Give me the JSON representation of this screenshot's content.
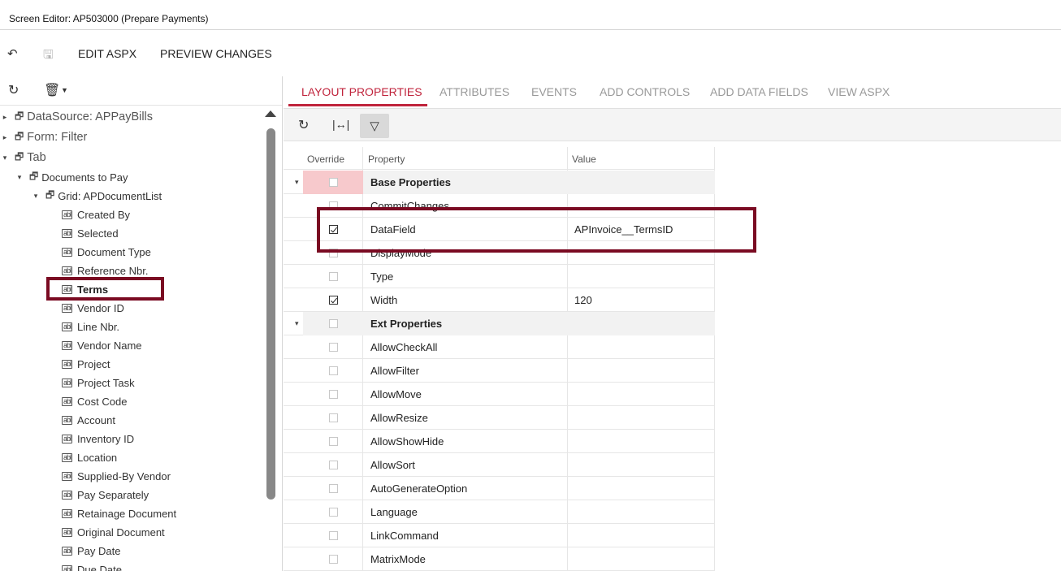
{
  "window": {
    "title": "Screen Editor: AP503000 (Prepare Payments)"
  },
  "toolbar": {
    "edit_aspx": "EDIT ASPX",
    "preview_changes": "PREVIEW CHANGES"
  },
  "tree": {
    "nodes": [
      {
        "label": "DataSource: APPayBills"
      },
      {
        "label": "Form: Filter"
      },
      {
        "label": "Tab"
      },
      {
        "label": "Documents to Pay"
      },
      {
        "label": "Grid: APDocumentList"
      },
      {
        "label": "Created By"
      },
      {
        "label": "Selected"
      },
      {
        "label": "Document Type"
      },
      {
        "label": "Reference Nbr."
      },
      {
        "label": "Terms"
      },
      {
        "label": "Vendor ID"
      },
      {
        "label": "Line Nbr."
      },
      {
        "label": "Vendor Name"
      },
      {
        "label": "Project"
      },
      {
        "label": "Project Task"
      },
      {
        "label": "Cost Code"
      },
      {
        "label": "Account"
      },
      {
        "label": "Inventory ID"
      },
      {
        "label": "Location"
      },
      {
        "label": "Supplied-By Vendor"
      },
      {
        "label": "Pay Separately"
      },
      {
        "label": "Retainage Document"
      },
      {
        "label": "Original Document"
      },
      {
        "label": "Pay Date"
      },
      {
        "label": "Due Date"
      }
    ]
  },
  "tabs": [
    {
      "label": "LAYOUT PROPERTIES"
    },
    {
      "label": "ATTRIBUTES"
    },
    {
      "label": "EVENTS"
    },
    {
      "label": "ADD CONTROLS"
    },
    {
      "label": "ADD DATA FIELDS"
    },
    {
      "label": "VIEW ASPX"
    }
  ],
  "grid": {
    "columns": {
      "override": "Override",
      "property": "Property",
      "value": "Value"
    },
    "rows": [
      {
        "property": "Base Properties",
        "value": "",
        "checked": false
      },
      {
        "property": "CommitChanges",
        "value": "",
        "checked": false
      },
      {
        "property": "DataField",
        "value": "APInvoice__TermsID",
        "checked": true
      },
      {
        "property": "DisplayMode",
        "value": "",
        "checked": false
      },
      {
        "property": "Type",
        "value": "",
        "checked": false
      },
      {
        "property": "Width",
        "value": "120",
        "checked": true
      },
      {
        "property": "Ext Properties",
        "value": "",
        "checked": false
      },
      {
        "property": "AllowCheckAll",
        "value": "",
        "checked": false
      },
      {
        "property": "AllowFilter",
        "value": "",
        "checked": false
      },
      {
        "property": "AllowMove",
        "value": "",
        "checked": false
      },
      {
        "property": "AllowResize",
        "value": "",
        "checked": false
      },
      {
        "property": "AllowShowHide",
        "value": "",
        "checked": false
      },
      {
        "property": "AllowSort",
        "value": "",
        "checked": false
      },
      {
        "property": "AutoGenerateOption",
        "value": "",
        "checked": false
      },
      {
        "property": "Language",
        "value": "",
        "checked": false
      },
      {
        "property": "LinkCommand",
        "value": "",
        "checked": false
      },
      {
        "property": "MatrixMode",
        "value": "",
        "checked": false
      }
    ]
  },
  "colors": {
    "accent": "#c0243c",
    "highlight_box": "#7a0a22"
  }
}
